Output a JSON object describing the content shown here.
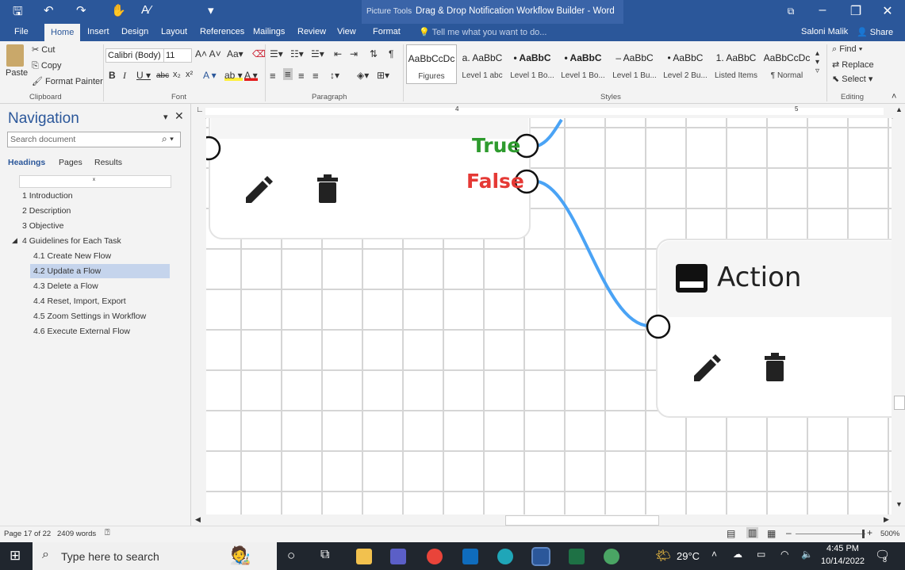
{
  "window": {
    "context_tools": "Picture Tools",
    "title": "Drag & Drop Notification Workflow Builder - Word"
  },
  "tabs": [
    "File",
    "Home",
    "Insert",
    "Design",
    "Layout",
    "References",
    "Mailings",
    "Review",
    "View",
    "Format"
  ],
  "tell_me": "Tell me what you want to do...",
  "user": "Saloni Malik",
  "share": "Share",
  "clipboard": {
    "paste": "Paste",
    "cut": "Cut",
    "copy": "Copy",
    "format_painter": "Format Painter",
    "label": "Clipboard"
  },
  "font": {
    "name": "Calibri (Body)",
    "size": "11",
    "label": "Font"
  },
  "paragraph": {
    "label": "Paragraph"
  },
  "styles": {
    "label": "Styles",
    "items": [
      {
        "sample": "AaBbCcDc",
        "name": "Figures"
      },
      {
        "sample": "a. AaBbC",
        "name": "Level 1 abc"
      },
      {
        "sample": "• AaBbC",
        "name": "Level 1 Bo..."
      },
      {
        "sample": "• AaBbC",
        "name": "Level 1 Bo..."
      },
      {
        "sample": "– AaBbC",
        "name": "Level 1 Bu..."
      },
      {
        "sample": "• AaBbC",
        "name": "Level 2 Bu..."
      },
      {
        "sample": "1. AaBbC",
        "name": "Listed Items"
      },
      {
        "sample": "AaBbCcDc",
        "name": "¶ Normal"
      }
    ]
  },
  "editing": {
    "find": "Find",
    "replace": "Replace",
    "select": "Select",
    "label": "Editing"
  },
  "nav": {
    "title": "Navigation",
    "search_placeholder": "Search document",
    "tabs": [
      "Headings",
      "Pages",
      "Results"
    ],
    "headings": [
      {
        "text": "1 Introduction"
      },
      {
        "text": "2 Description"
      },
      {
        "text": "3 Objective"
      },
      {
        "text": "4 Guidelines for Each Task"
      },
      {
        "text": "4.1 Create New Flow"
      },
      {
        "text": "4.2 Update a Flow"
      },
      {
        "text": "4.3 Delete a Flow"
      },
      {
        "text": "4.4 Reset, Import, Export"
      },
      {
        "text": "4.5 Zoom Settings in Workflow"
      },
      {
        "text": "4.6 Execute External Flow"
      }
    ]
  },
  "ruler": {
    "marks": [
      "4",
      "5"
    ]
  },
  "diagram": {
    "true_label": "True",
    "false_label": "False",
    "action_title": "Action",
    "colors": {
      "true": "#2e9b2e",
      "false": "#e53935",
      "connector": "#4aa3f5"
    }
  },
  "status": {
    "page": "Page 17 of 22",
    "words": "2409 words",
    "zoom": "500%"
  },
  "taskbar": {
    "search": "Type here to search",
    "weather": "29°C",
    "time": "4:45 PM",
    "date": "10/14/2022",
    "notifications": "8"
  }
}
